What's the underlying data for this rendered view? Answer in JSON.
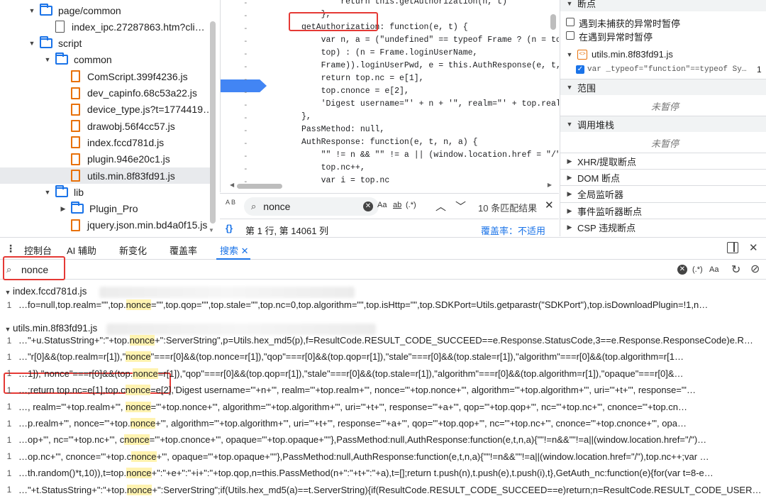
{
  "tree": {
    "items": [
      {
        "label": "page/common",
        "kind": "folder",
        "expanded": true
      },
      {
        "label": "index_ipc.27287863.htm?cli…",
        "kind": "page"
      },
      {
        "label": "script",
        "kind": "folder",
        "expanded": true
      },
      {
        "label": "common",
        "kind": "folder",
        "expanded": true
      },
      {
        "label": "ComScript.399f4236.js",
        "kind": "file"
      },
      {
        "label": "dev_capinfo.68c53a22.js",
        "kind": "file"
      },
      {
        "label": "device_type.js?t=1774419…",
        "kind": "file"
      },
      {
        "label": "drawobj.56f4cc57.js",
        "kind": "file"
      },
      {
        "label": "index.fccd781d.js",
        "kind": "file"
      },
      {
        "label": "plugin.946e20c1.js",
        "kind": "file"
      },
      {
        "label": "utils.min.8f83fd91.js",
        "kind": "file",
        "selected": true
      },
      {
        "label": "lib",
        "kind": "folder",
        "expanded": true
      },
      {
        "label": "Plugin_Pro",
        "kind": "folder",
        "expanded": false
      },
      {
        "label": "jquery.json.min.bd4a0f15.js",
        "kind": "file"
      }
    ]
  },
  "editor": {
    "lines": [
      "        return this.getAuthorization(n, t)",
      "    },",
      "getAuthorization: function(e, t) {",
      "    var n, a = (\"undefined\" == typeof Frame ? (n = top.",
      "    top) : (n = Frame.loginUserName,",
      "    Frame)).loginUserPwd, e = this.AuthResponse(e, t, n",
      "    return top.nc = e[1],",
      "    top.cnonce = e[2],",
      "    'Digest username=\"' + n + '\", realm=\"' + top.realm",
      "},",
      "PassMethod: null,",
      "AuthResponse: function(e, t, n, a) {",
      "    \"\" != n && \"\" != a || (window.location.href = \"/\"),",
      "    top.nc++,",
      "    var i = top.nc"
    ],
    "find": {
      "ab_label": "A B",
      "value": "nonce",
      "opt_case": "Aa",
      "opt_word": "ab",
      "opt_regex": "(.*)",
      "count": "10 条匹配结果"
    },
    "status": {
      "braces": "{}",
      "position": "第 1 行, 第 14061 列",
      "coverage": "覆盖率：不适用"
    }
  },
  "debugger": {
    "breakpoints_title": "断点",
    "pause_uncaught": "遇到未捕获的异常时暂停",
    "pause_caught": "在遇到异常时暂停",
    "bp_file": "utils.min.8f83fd91.js",
    "bp_code": "var _typeof=\"function\"==typeof Sy…",
    "bp_line": "1",
    "scope_title": "范围",
    "not_paused": "未暂停",
    "callstack_title": "调用堆栈",
    "not_paused2": "未暂停",
    "xhr": "XHR/提取断点",
    "dom": "DOM 断点",
    "global": "全局监听器",
    "event": "事件监听器断点",
    "csp": "CSP 违规断点"
  },
  "drawer": {
    "tabs": [
      "控制台",
      "AI 辅助",
      "新变化",
      "覆盖率",
      "搜索"
    ],
    "active_tab": "搜索",
    "search_value": "nonce",
    "opt_regex": "(.*)",
    "opt_case": "Aa"
  },
  "results": {
    "file1": "index.fccd781d.js",
    "file1_lines": [
      {
        "num": "1",
        "parts": [
          "…fo=null,top.realm=\"\",top.",
          "nonce",
          "=\"\",top.qop=\"\",top.stale=\"\",top.nc=0,top.algorithm=\"\",top.isHttp=\"\",top.SDKPort=Utils.getparastr(\"SDKPort\"),top.isDownloadPlugin=!1,n…"
        ]
      }
    ],
    "file2": "utils.min.8f83fd91.js",
    "file2_lines": [
      {
        "num": "1",
        "parts": [
          "…\"+u.StatusString+\":\"+top.",
          "nonce",
          "+\":ServerString\",p=Utils.hex_md5(p),f=ResultCode.RESULT_CODE_SUCCEED==e.Response.StatusCode,3==e.Response.ResponseCode)e.R…"
        ]
      },
      {
        "num": "1",
        "parts": [
          "…\"r[0]&&(top.realm=r[1]),\"",
          "nonce",
          "\"===r[0]&&(top.nonce=r[1]),\"qop\"===r[0]&&(top.qop=r[1]),\"stale\"===r[0]&&(top.stale=r[1]),\"algorithm\"===r[0]&&(top.algorithm=r[1…"
        ]
      },
      {
        "num": "1",
        "parts": [
          "…1]),\"nonce\"===r[0]&&(top.",
          "nonce",
          "=r[1]),\"qop\"===r[0]&&(top.qop=r[1]),\"stale\"===r[0]&&(top.stale=r[1]),\"algorithm\"===r[0]&&(top.algorithm=r[1]),\"opaque\"===r[0]&…"
        ]
      },
      {
        "num": "1",
        "parts": [
          "…;return top.nc=e[1],top.c",
          "nonce",
          "=e[2],'Digest username=\"'+n+'\", realm=\"'+top.realm+'\", nonce=\"'+top.nonce+'\", algorithm=\"'+top.algorithm+'\", uri=\"'+t+'\", response=\"'…"
        ]
      },
      {
        "num": "1",
        "parts": [
          "…, realm=\"'+top.realm+'\", ",
          "nonce",
          "=\"'+top.nonce+'\", algorithm=\"'+top.algorithm+'\", uri=\"'+t+'\", response=\"'+a+'\", qop=\"'+top.qop+'\", nc=\"'+top.nc+'\", cnonce=\"'+top.cn…"
        ]
      },
      {
        "num": "1",
        "parts": [
          "…p.realm+'\", nonce=\"'+top.",
          "nonce",
          "+'\", algorithm=\"'+top.algorithm+'\", uri=\"'+t+'\", response=\"'+a+'\", qop=\"'+top.qop+'\", nc=\"'+top.nc+'\", cnonce=\"'+top.cnonce+'\", opa…"
        ]
      },
      {
        "num": "1",
        "parts": [
          "…op+'\", nc=\"'+top.nc+'\", c",
          "nonce",
          "=\"'+top.cnonce+'\", opaque=\"'+top.opaque+'\"'},PassMethod:null,AuthResponse:function(e,t,n,a){\"\"!=n&&\"\"!=a||(window.location.href=\"/\")…"
        ]
      },
      {
        "num": "1",
        "parts": [
          "…op.nc+'\", cnonce=\"'+top.c",
          "nonce",
          "+'\", opaque=\"'+top.opaque+'\"'},PassMethod:null,AuthResponse:function(e,t,n,a){\"\"!=n&&\"\"!=a||(window.location.href=\"/\"),top.nc++;var …"
        ]
      },
      {
        "num": "1",
        "parts": [
          "…th.random()*t,10)),t=top.",
          "nonce",
          "+\":\"+e+\":\"+i+\":\"+top.qop,n=this.PassMethod(n+\":\"+t+\":\"+a),t=[];return t.push(n),t.push(e),t.push(i),t},GetAuth_nc:function(e){for(var t=8-e…"
        ]
      },
      {
        "num": "1",
        "parts": [
          "…\"+t.StatusString+\":\"+top.",
          "nonce",
          "+\":ServerString\";if(Utils.hex_md5(a)==t.ServerString){if(ResultCode.RESULT_CODE_SUCCEED==e)return;n=ResultCode.RESULT_CODE_USER…"
        ]
      }
    ]
  }
}
